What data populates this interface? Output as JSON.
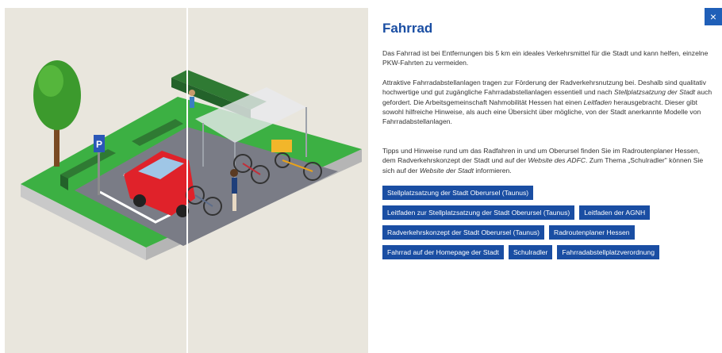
{
  "panel": {
    "close_icon": "×",
    "title": "Fahrrad",
    "p1": "Das Fahrrad ist bei Entfernungen bis 5 km ein ideales Verkehrsmittel für die Stadt und kann helfen, einzelne PKW-Fahrten zu vermeiden.",
    "p2_a": "Attraktive Fahrradabstellanlagen tragen zur Förderung der Radverkehrsnutzung bei. Deshalb sind qualitativ hochwertige und gut zugängliche Fahrradabstellanlagen essentiell und nach ",
    "p2_em1": "Stellplatzsatzung der Stadt",
    "p2_b": " auch gefordert. Die Arbeitsgemeinschaft Nahmobilität Hessen hat einen ",
    "p2_em2": "Leitfaden",
    "p2_c": " herausgebracht. Dieser gibt sowohl hilfreiche Hinweise, als auch eine Übersicht über mögliche, von der Stadt anerkannte Modelle von Fahrradabstellanlagen.",
    "p3_a": "Tipps und Hinweise rund um das Radfahren in und um Oberursel finden Sie im Radroutenplaner Hessen, dem Radverkehrskonzept der Stadt und auf der ",
    "p3_em1": "Website des ADFC",
    "p3_b": ". Zum Thema „Schulradler\" können Sie sich auf der ",
    "p3_em2": "Website der Stadt",
    "p3_c": " informieren.",
    "links": [
      [
        "Stellplatzsatzung der Stadt Oberursel (Taunus)"
      ],
      [
        "Leitfaden zur Stellplatzsatzung der Stadt Oberursel (Taunus)",
        "Leitfaden der AGNH"
      ],
      [
        "Radverkehrskonzept der Stadt Oberursel (Taunus)",
        "Radroutenplaner Hessen"
      ],
      [
        "Fahrrad auf der Homepage der Stadt",
        "Schulradler",
        "Fahrradabstellplatzverordnung"
      ]
    ]
  },
  "illustration": {
    "parking_sign": "P"
  }
}
